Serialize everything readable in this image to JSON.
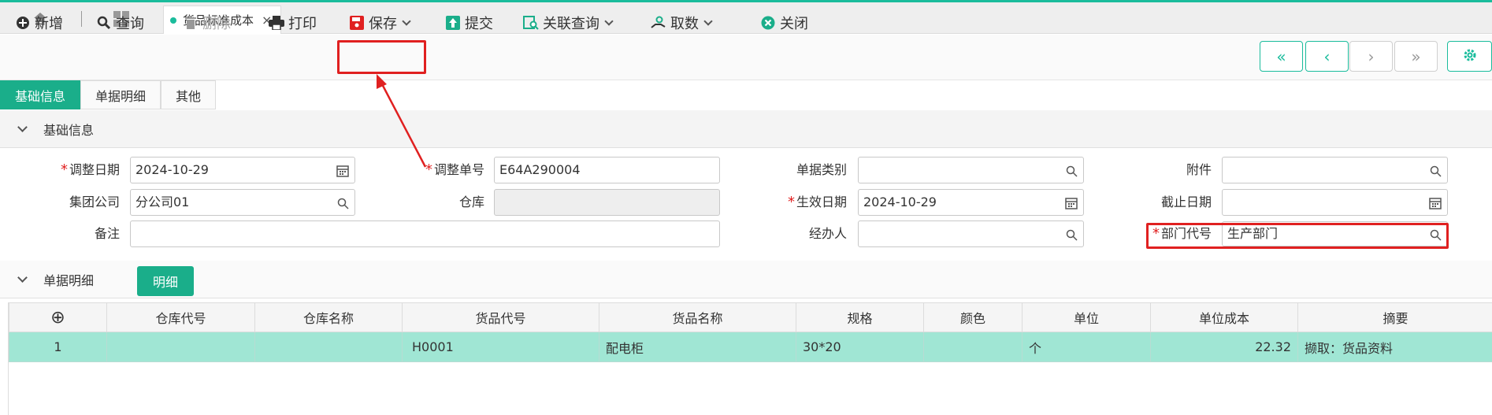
{
  "tabs": {
    "doc_label": "货品标准成本",
    "close_glyph": "×"
  },
  "toolbar": {
    "add": "新增",
    "query": "查询",
    "delete": "删除",
    "print": "打印",
    "save": "保存",
    "submit": "提交",
    "related_query": "关联查询",
    "fetch": "取数",
    "close": "关闭"
  },
  "nav": {
    "first": "«",
    "prev": "‹",
    "next": "›",
    "last": "»"
  },
  "section_tabs": [
    "基础信息",
    "单据明细",
    "其他"
  ],
  "basic": {
    "heading": "基础信息",
    "fields": {
      "adjust_date_label": "调整日期",
      "adjust_date": "2024-10-29",
      "adjust_no_label": "调整单号",
      "adjust_no": "E64A290004",
      "doc_type_label": "单据类别",
      "doc_type": "",
      "attachment_label": "附件",
      "attachment": "",
      "group_company_label": "集团公司",
      "group_company": "分公司01",
      "warehouse_label": "仓库",
      "warehouse": "",
      "effective_date_label": "生效日期",
      "effective_date": "2024-10-29",
      "cutoff_date_label": "截止日期",
      "cutoff_date": "",
      "remark_label": "备注",
      "remark": "",
      "handler_label": "经办人",
      "handler": "",
      "dept_code_label": "部门代号",
      "dept_code": "生产部门"
    }
  },
  "detail": {
    "heading": "单据明细",
    "button": "明细",
    "add_glyph": "⊕",
    "columns": [
      "仓库代号",
      "仓库名称",
      "货品代号",
      "货品名称",
      "规格",
      "颜色",
      "单位",
      "单位成本",
      "摘要"
    ],
    "rows": [
      {
        "no": "1",
        "wh_code": "",
        "wh_name": "",
        "item_code": "H0001",
        "item_name": "配电柜",
        "spec": "30*20",
        "color": "",
        "unit": "个",
        "unit_cost": "22.32",
        "summary": "撷取：货品资料"
      }
    ]
  },
  "colors": {
    "accent": "#1aae8a",
    "highlight": "#e02020",
    "row": "#a0e6d4"
  }
}
